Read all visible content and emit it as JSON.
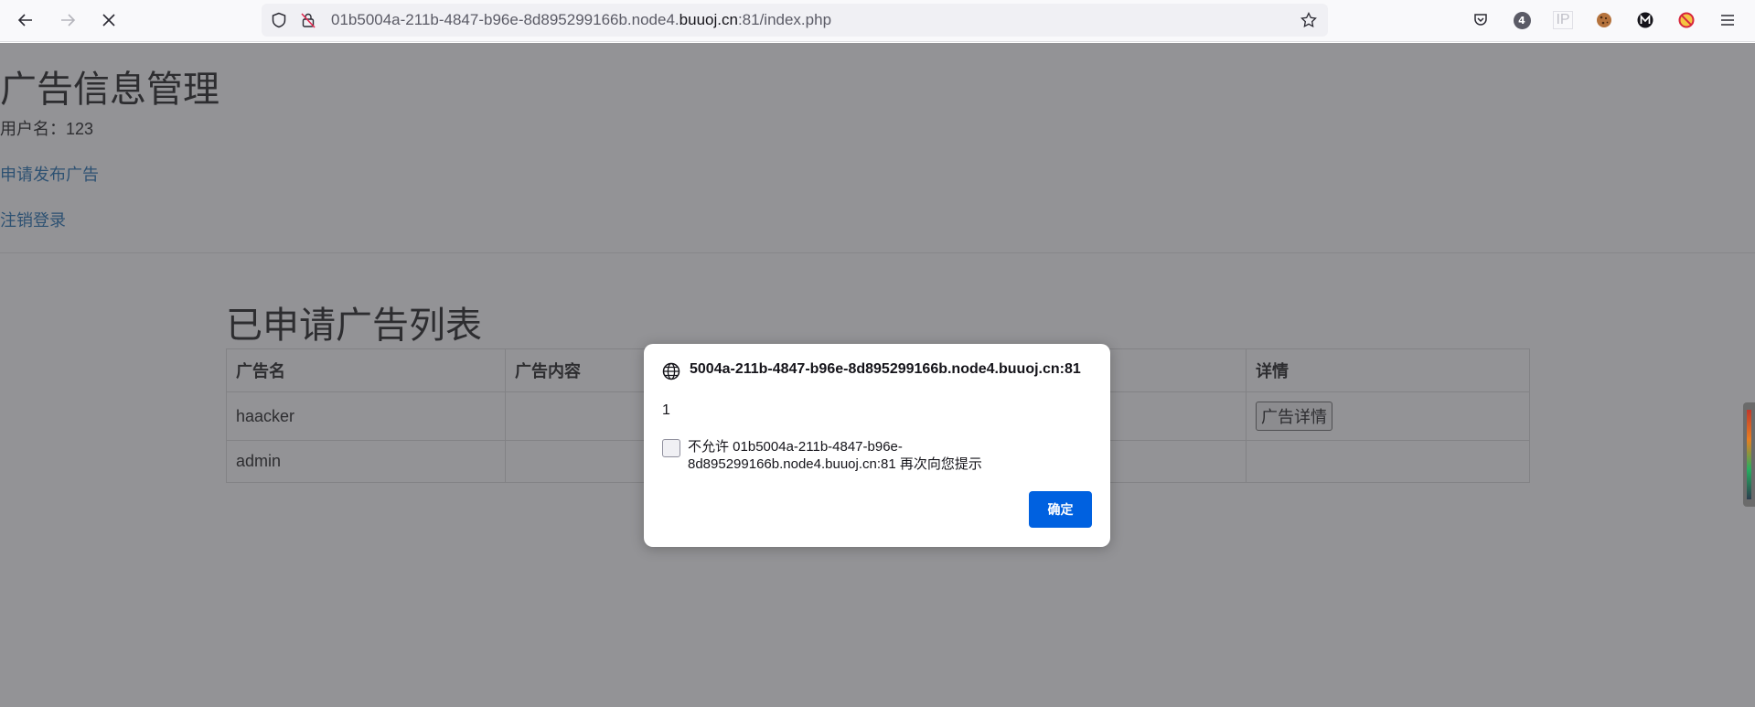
{
  "browser": {
    "url_prefix": "01b5004a-211b-4847-b96e-8d895299166b.node4.",
    "url_domain": "buuoj.cn",
    "url_suffix": ":81/index.php",
    "extension_badge": "4",
    "ip_ext_label": "IP"
  },
  "page": {
    "title": "广告信息管理",
    "username": "用户名：123",
    "apply_link": "申请发布广告",
    "logout_link": "注销登录",
    "list_title": "已申请广告列表",
    "table": {
      "headers": [
        "广告名",
        "广告内容",
        "",
        "详情"
      ],
      "rows": [
        {
          "name": "haacker",
          "content": "",
          "detail_button": "广告详情"
        },
        {
          "name": "admin",
          "content": "",
          "detail_button": ""
        }
      ]
    }
  },
  "dialog": {
    "title": "5004a-211b-4847-b96e-8d895299166b.node4.buuoj.cn:81",
    "message": "1",
    "checkbox_label": "不允许 01b5004a-211b-4847-b96e-8d895299166b.node4.buuoj.cn:81 再次向您提示",
    "ok_button": "确定"
  },
  "colors": {
    "link": "#337ab7",
    "primary_button": "#0061e0",
    "overlay": "#28282d"
  }
}
